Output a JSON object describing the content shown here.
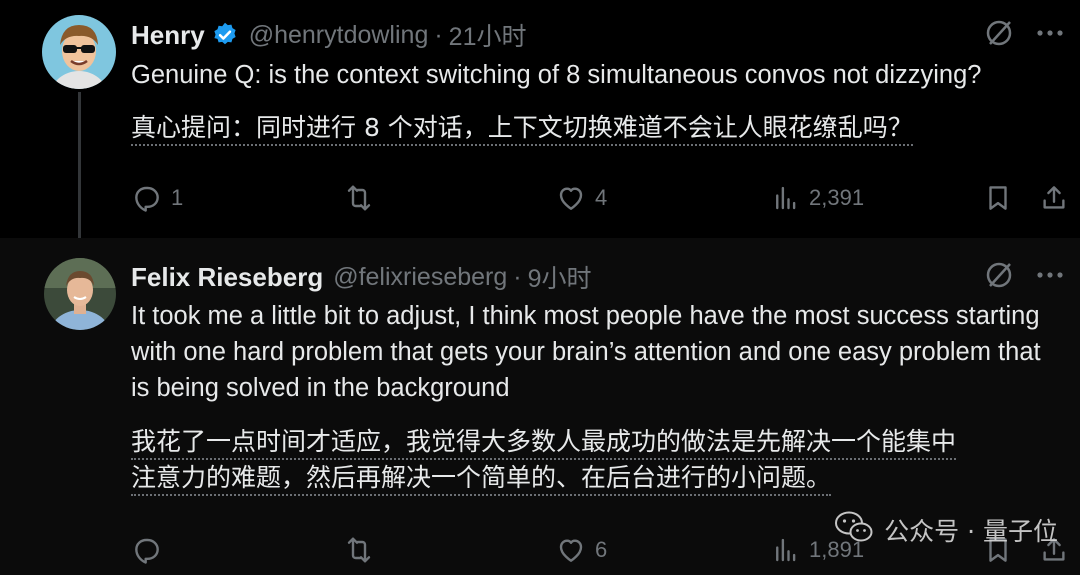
{
  "tweets": [
    {
      "name": "Henry",
      "handle": "@henrytdowling",
      "separator": "·",
      "time": "21小时",
      "text_en": "Genuine Q: is the context switching of 8 simultaneous convos not dizzying?",
      "text_zh": [
        "真心提问：同时进行 8 个对话，上下文切换难道不会让人眼花缭乱吗？"
      ],
      "replies": "1",
      "retweets": "",
      "likes": "4",
      "views": "2,391"
    },
    {
      "name": "Felix Rieseberg",
      "handle": "@felixrieseberg",
      "separator": "·",
      "time": "9小时",
      "text_en": "It took me a little bit to adjust, I think most people have the most success starting with one hard problem that gets your brain’s attention and one easy problem that is being solved in the background",
      "text_zh": [
        "我花了一点时间才适应，我觉得大多数人最成功的做法是先解决一个能集中",
        "注意力的难题，然后再解决一个简单的、在后台进行的小问题。"
      ],
      "replies": "",
      "retweets": "",
      "likes": "6",
      "views": "1,891"
    }
  ],
  "watermark": {
    "text": "公众号 · 量子位",
    "icon": "wechat-icon"
  },
  "colors": {
    "background": "#000000",
    "text": "#e7e9ea",
    "muted": "#71767b",
    "verified": "#1d9bf0"
  }
}
